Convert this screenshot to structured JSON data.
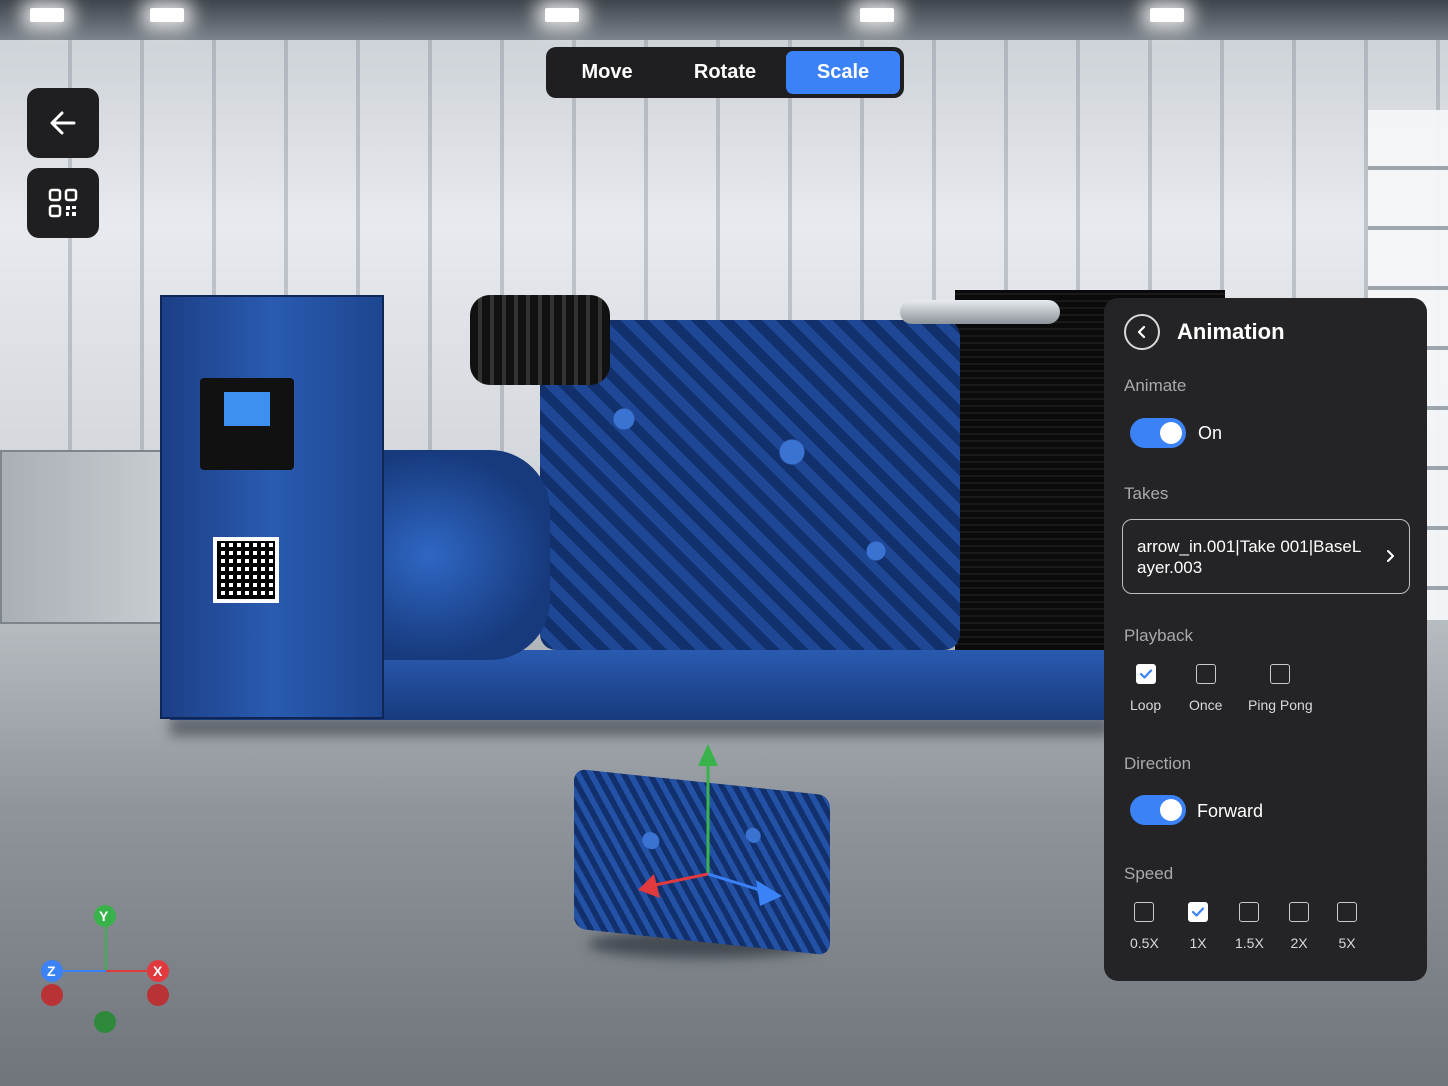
{
  "toolbar": {
    "modes": [
      "Move",
      "Rotate",
      "Scale"
    ],
    "active_mode": "Scale"
  },
  "axes": {
    "y": "Y",
    "z": "Z",
    "x": "X"
  },
  "panel": {
    "title": "Animation",
    "animate": {
      "label": "Animate",
      "state_label": "On",
      "enabled": true
    },
    "takes": {
      "label": "Takes",
      "value": "arrow_in.001|Take 001|BaseLayer.003"
    },
    "playback": {
      "label": "Playback",
      "options": [
        "Loop",
        "Once",
        "Ping Pong"
      ],
      "selected": "Loop"
    },
    "direction": {
      "label": "Direction",
      "state_label": "Forward",
      "enabled": true
    },
    "speed": {
      "label": "Speed",
      "options": [
        "0.5X",
        "1X",
        "1.5X",
        "2X",
        "5X"
      ],
      "selected": "1X"
    }
  },
  "colors": {
    "accent": "#3b82f6",
    "panel_bg": "#242426",
    "axis_x": "#e0393e",
    "axis_y": "#38b24a",
    "axis_z": "#3b82f6"
  },
  "icons": {
    "back": "arrow-left-icon",
    "qr": "qr-code-icon",
    "panel_back": "chevron-left-icon",
    "takes_chevron": "chevron-right-icon",
    "check": "checkmark-icon"
  }
}
